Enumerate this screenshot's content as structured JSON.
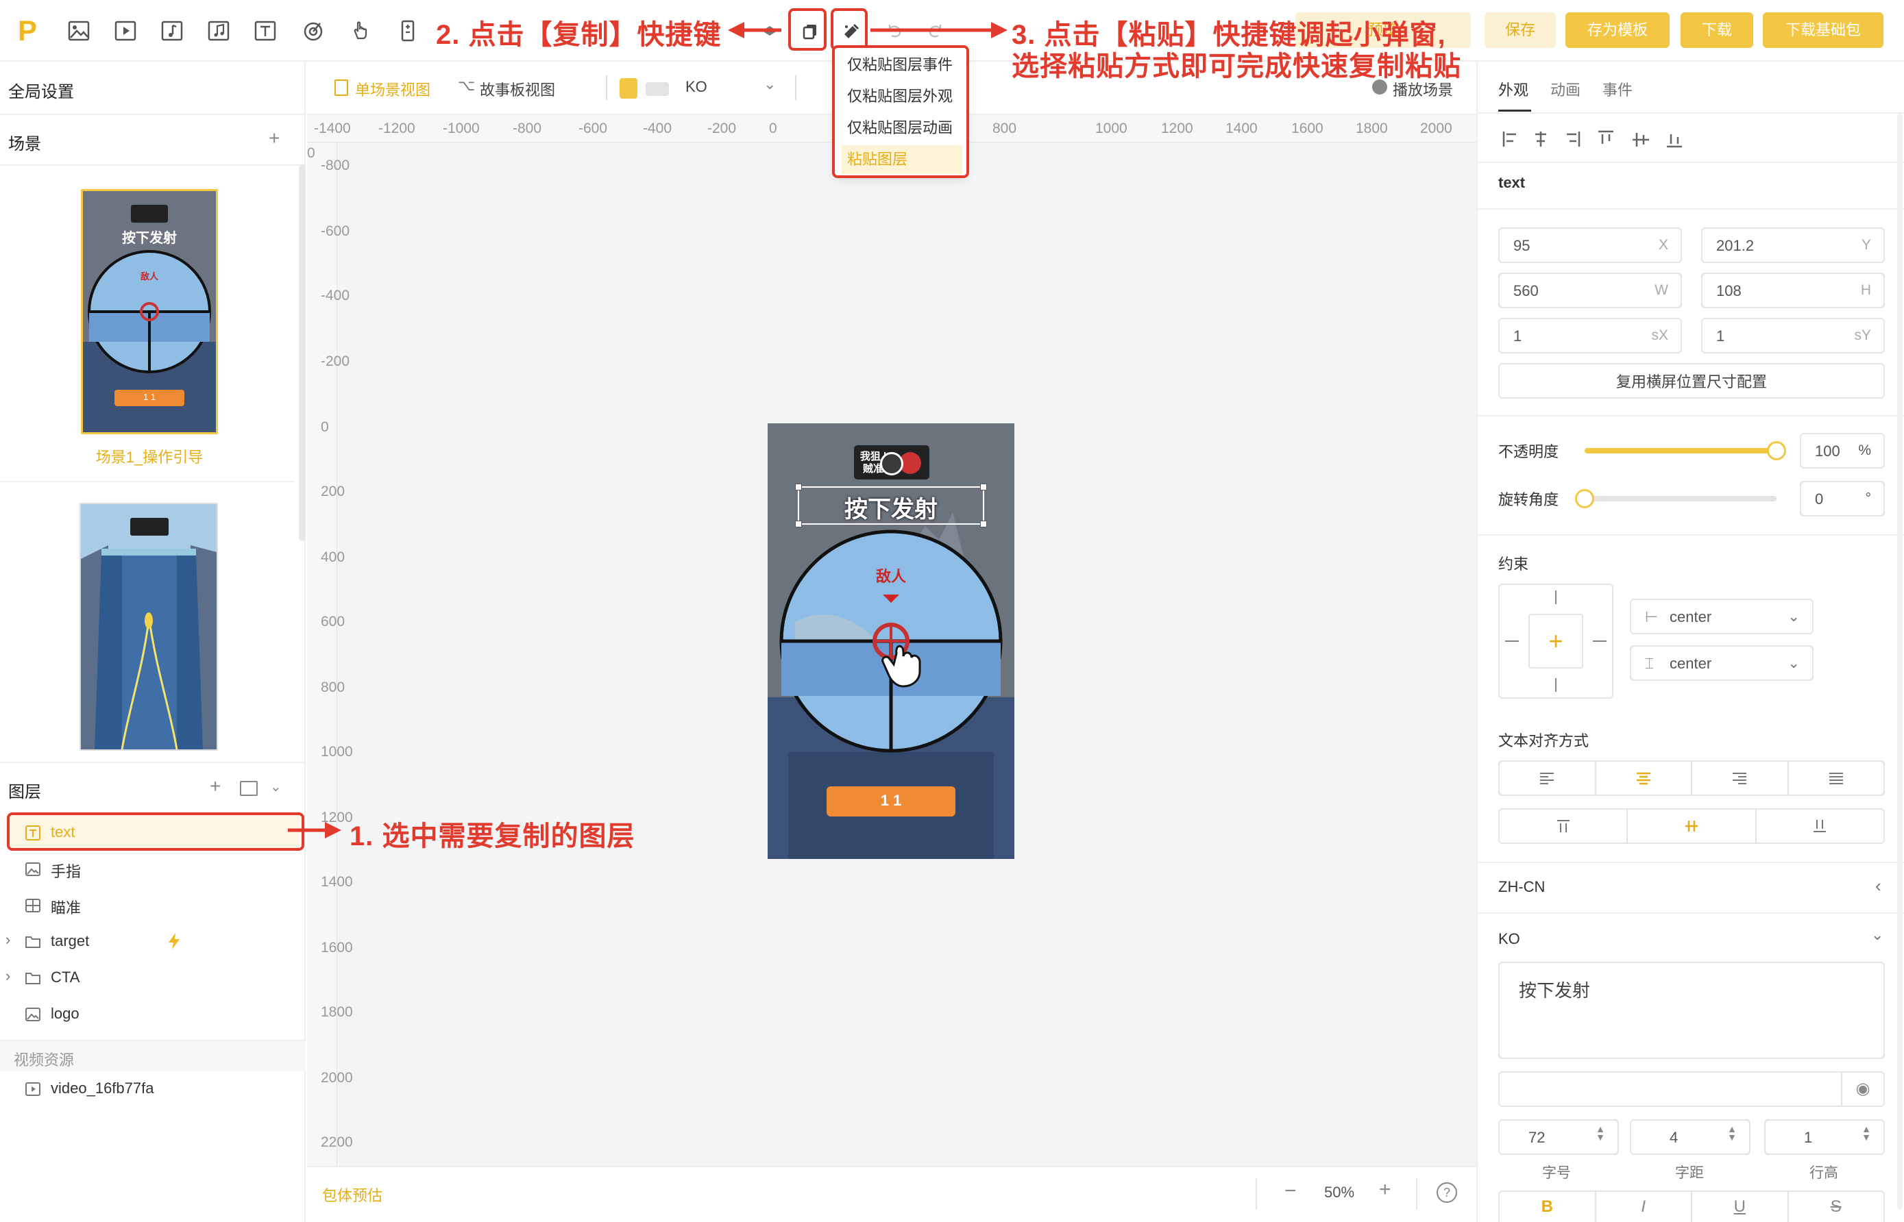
{
  "toolbar": {
    "logo": "P",
    "preview_label": "预览",
    "save_label": "保存",
    "save_template_label": "存为模板",
    "download_label": "下载",
    "download_base_label": "下载基础包"
  },
  "paste_menu": {
    "items": [
      "仅粘贴图层事件",
      "仅粘贴图层外观",
      "仅粘贴图层动画",
      "粘贴图层"
    ]
  },
  "left": {
    "global_settings": "全局设置",
    "scenes_title": "场景",
    "scene1_name": "场景1_操作引导",
    "scene_thumb_text": "按下发射",
    "scene_thumb_enemy": "敌人",
    "scene_thumb_btn": "1 1",
    "layers_title": "图层",
    "layers": [
      {
        "name": "text",
        "icon": "text-icon"
      },
      {
        "name": "手指",
        "icon": "image-icon"
      },
      {
        "name": "瞄准",
        "icon": "widget-icon"
      },
      {
        "name": "target",
        "icon": "folder-icon"
      },
      {
        "name": "CTA",
        "icon": "folder-icon"
      },
      {
        "name": "logo",
        "icon": "image-icon"
      }
    ],
    "video_section": "视频资源",
    "video_item": "video_16fb77fa"
  },
  "canvas": {
    "single_view": "单场景视图",
    "story_view": "故事板视图",
    "lang": "KO",
    "play_scene": "播放场景",
    "ruler_x": [
      "-1400",
      "-1200",
      "-1000",
      "-800",
      "-600",
      "-400",
      "-200",
      "0",
      "800",
      "1000",
      "1200",
      "1400",
      "1600",
      "1800",
      "2000"
    ],
    "ruler_y": [
      "0",
      "-800",
      "-600",
      "-400",
      "-200",
      "0",
      "200",
      "400",
      "600",
      "800",
      "1000",
      "1200",
      "1400",
      "1600",
      "1800",
      "2000",
      "2200"
    ],
    "phone_text": "按下发射",
    "phone_enemy": "敌人",
    "phone_badge": "我狙 | 贼准",
    "phone_btn": "1 1",
    "pkg_estimate": "包体预估",
    "zoom": "50%"
  },
  "right": {
    "tabs": [
      "外观",
      "动画",
      "事件"
    ],
    "layer_name": "text",
    "x": "95",
    "x_unit": "X",
    "y": "201.2",
    "y_unit": "Y",
    "w": "560",
    "w_unit": "W",
    "h": "108",
    "h_unit": "H",
    "sx": "1",
    "sx_unit": "sX",
    "sy": "1",
    "sy_unit": "sY",
    "reuse_btn": "复用横屏位置尺寸配置",
    "opacity_label": "不透明度",
    "opacity": "100",
    "opacity_unit": "%",
    "opacity_level": 1.0,
    "rotation_label": "旋转角度",
    "rotation": "0",
    "rotation_unit": "°",
    "rotation_level": 0.0,
    "constraint_label": "约束",
    "constraint_h": "center",
    "constraint_v": "center",
    "text_align_label": "文本对齐方式",
    "lang_zh": "ZH-CN",
    "lang_ko": "KO",
    "text_content": "按下发射",
    "font_size": "72",
    "font_size_label": "字号",
    "letter_spacing": "4",
    "letter_spacing_label": "字距",
    "line_height": "1",
    "line_height_label": "行高",
    "bold": "B",
    "italic": "I",
    "underline": "U",
    "strike": "S"
  },
  "annotations": {
    "step1": "1. 选中需要复制的图层",
    "step2": "2. 点击【复制】快捷键",
    "step3_line1": "3. 点击【粘贴】快捷键调起小弹窗,",
    "step3_line2": "选择粘贴方式即可完成快速复制粘贴"
  },
  "colors": {
    "accent": "#f3c643",
    "accent_text": "#e6ad15",
    "annotation": "#e23b2d"
  }
}
